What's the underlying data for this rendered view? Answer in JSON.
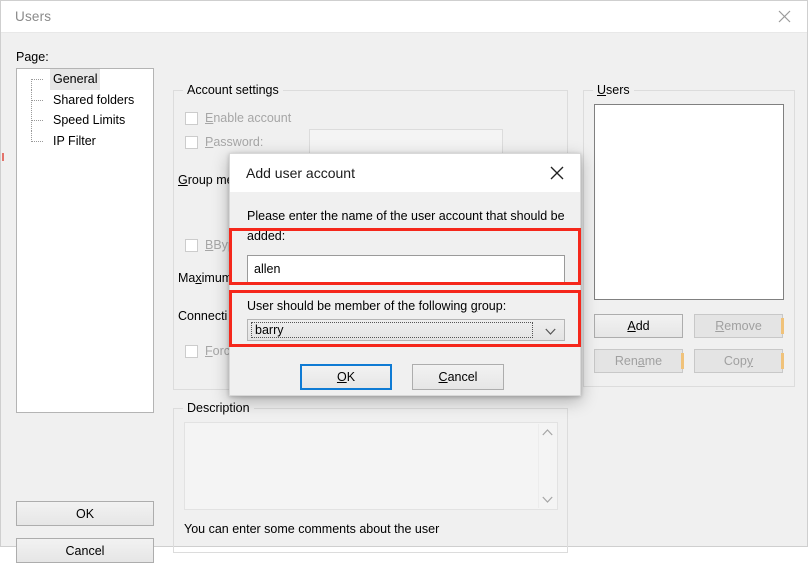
{
  "window": {
    "title": "Users",
    "close_icon": "close-icon"
  },
  "left_panel": {
    "page_label": "Page:",
    "tree_items": [
      {
        "label": "General",
        "selected": true
      },
      {
        "label": "Shared folders",
        "selected": false
      },
      {
        "label": "Speed Limits",
        "selected": false
      },
      {
        "label": "IP Filter",
        "selected": false
      }
    ],
    "ok_label": "OK",
    "cancel_label": "Cancel"
  },
  "account_settings": {
    "group_title": "Account settings",
    "enable_account_label": "Enable account",
    "password_label": "Password:",
    "password_value": "",
    "group_membership_label": "Group membership:",
    "group_membership_value": "",
    "bypass_label": "Bypas",
    "maximum_label": "Maximum",
    "connection_label": "Connecti",
    "force_label": "Forc"
  },
  "description": {
    "group_title": "Description",
    "text_value": "",
    "hint": "You can enter some comments about the user",
    "scroll_up_icon": "chevron-up-icon",
    "scroll_down_icon": "chevron-down-icon"
  },
  "users_panel": {
    "group_title": "Users",
    "list_items": [],
    "buttons": [
      {
        "label": "Add",
        "mnemonic": "A",
        "disabled": false
      },
      {
        "label": "Remove",
        "mnemonic": "R",
        "disabled": true
      },
      {
        "label": "Rename",
        "mnemonic": "a",
        "disabled": true
      },
      {
        "label": "Copy",
        "mnemonic": "y",
        "disabled": true
      }
    ]
  },
  "dialog": {
    "title": "Add user account",
    "close_icon": "close-icon",
    "prompt": "Please enter the name of the user account that should be added:",
    "name_value": "allen",
    "group_label": "User should be member of the following group:",
    "group_value": "barry",
    "dropdown_icon": "chevron-down-icon",
    "ok_label": "OK",
    "cancel_label": "Cancel"
  },
  "annotations": {
    "highlight_color": "#f5271b",
    "focus_color": "#0f7bd4",
    "boxes": [
      {
        "name": "name-field-highlight"
      },
      {
        "name": "group-combo-highlight"
      }
    ]
  }
}
